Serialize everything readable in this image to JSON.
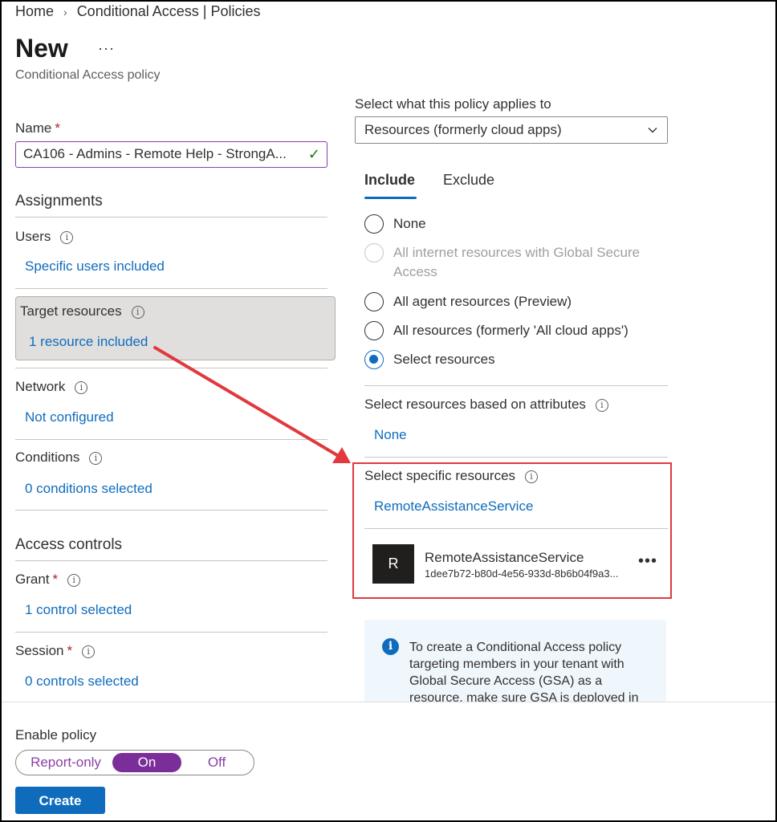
{
  "breadcrumb": {
    "home": "Home",
    "current": "Conditional Access | Policies"
  },
  "page": {
    "title": "New",
    "more": "···",
    "subtitle": "Conditional Access policy"
  },
  "name_field": {
    "label": "Name",
    "required": "*",
    "value": "CA106 - Admins - Remote Help - StrongA..."
  },
  "assignments": {
    "heading": "Assignments",
    "users": {
      "label": "Users",
      "value": "Specific users included"
    },
    "target_resources": {
      "label": "Target resources",
      "value": "1 resource included"
    },
    "network": {
      "label": "Network",
      "value": "Not configured"
    },
    "conditions": {
      "label": "Conditions",
      "value": "0 conditions selected"
    }
  },
  "access_controls": {
    "heading": "Access controls",
    "grant": {
      "label": "Grant",
      "required": "*",
      "value": "1 control selected"
    },
    "session": {
      "label": "Session",
      "required": "*",
      "value": "0 controls selected"
    }
  },
  "applies_to": {
    "label": "Select what this policy applies to",
    "selected": "Resources (formerly cloud apps)"
  },
  "tabs": [
    {
      "label": "Include",
      "active": true
    },
    {
      "label": "Exclude",
      "active": false
    }
  ],
  "radios": [
    {
      "label": "None",
      "state": "unchecked"
    },
    {
      "label": "All internet resources with Global Secure Access",
      "state": "disabled"
    },
    {
      "label": "All agent resources (Preview)",
      "state": "unchecked"
    },
    {
      "label": "All resources (formerly 'All cloud apps')",
      "state": "unchecked"
    },
    {
      "label": "Select resources",
      "state": "checked"
    }
  ],
  "attributes": {
    "label": "Select resources based on attributes",
    "value": "None"
  },
  "specific": {
    "label": "Select specific resources",
    "value": "RemoteAssistanceService",
    "item": {
      "avatar": "R",
      "name": "RemoteAssistanceService",
      "id": "1dee7b72-b80d-4e56-933d-8b6b04f9a3...",
      "more": "•••"
    }
  },
  "notice": {
    "text": "To create a Conditional Access policy targeting members in your tenant with Global Secure Access (GSA) as a resource, make sure GSA is deployed in"
  },
  "enable_policy": {
    "label": "Enable policy",
    "options": [
      "Report-only",
      "On",
      "Off"
    ],
    "selected": "On"
  },
  "create_button": "Create",
  "colors": {
    "accent": "#0f6cbd",
    "toggle_on": "#7b2e9a",
    "annotation": "#e0393e"
  }
}
